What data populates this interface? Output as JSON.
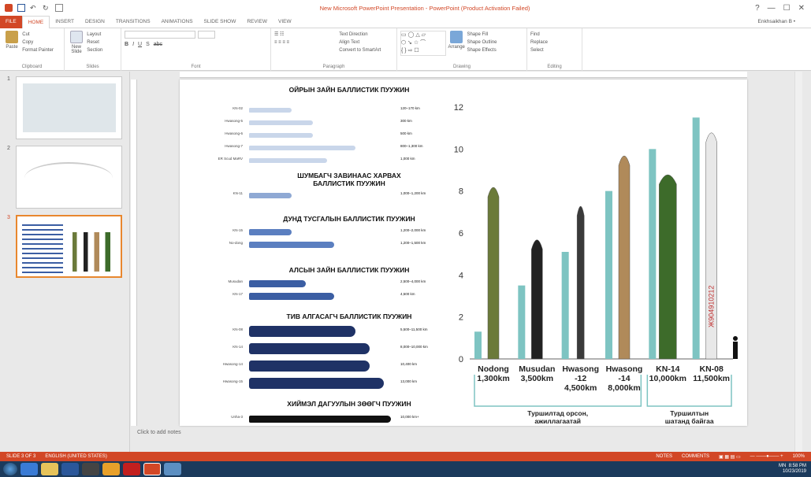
{
  "window": {
    "title": "New Microsoft PowerPoint Presentation - PowerPoint (Product Activation Failed)",
    "user": "Enkhsaikhan B •",
    "controls": [
      "?",
      "—",
      "☐",
      "✕"
    ]
  },
  "tabs": [
    "FILE",
    "HOME",
    "INSERT",
    "DESIGN",
    "TRANSITIONS",
    "ANIMATIONS",
    "SLIDE SHOW",
    "REVIEW",
    "VIEW"
  ],
  "ribbon": {
    "clipboard": {
      "label": "Clipboard",
      "paste": "Paste",
      "cut": "Cut",
      "copy": "Copy",
      "format_painter": "Format Painter"
    },
    "slides": {
      "label": "Slides",
      "new_slide": "New Slide",
      "layout": "Layout",
      "reset": "Reset",
      "section": "Section"
    },
    "font": {
      "label": "Font"
    },
    "paragraph": {
      "label": "Paragraph",
      "text_direction": "Text Direction",
      "align_text": "Align Text",
      "convert": "Convert to SmartArt"
    },
    "drawing": {
      "label": "Drawing",
      "arrange": "Arrange",
      "quick_styles": "Quick Styles",
      "shape_fill": "Shape Fill",
      "shape_outline": "Shape Outline",
      "shape_effects": "Shape Effects"
    },
    "editing": {
      "label": "Editing",
      "find": "Find",
      "replace": "Replace",
      "select": "Select"
    }
  },
  "thumbnails": [
    "1",
    "2",
    "3"
  ],
  "notes_placeholder": "Click to add notes",
  "status": {
    "slide": "SLIDE 3 OF 3",
    "language": "ENGLISH (UNITED STATES)",
    "notes": "NOTES",
    "comments": "COMMENTS",
    "zoom": "100%"
  },
  "clock": {
    "time": "8:58 PM",
    "date": "10/23/2019",
    "lang": "MN"
  },
  "infographic": {
    "sections": [
      {
        "title": "ОЙРЫН ЗАЙН БАЛЛИСТИК ПУУЖИН",
        "color": "#c9d6ea",
        "rows": [
          {
            "name": "KN-02",
            "range": "120–170 km",
            "len": 0.3
          },
          {
            "name": "Hwasong-5",
            "range": "300 km",
            "len": 0.45
          },
          {
            "name": "Hwasong-6",
            "range": "500 km",
            "len": 0.45
          },
          {
            "name": "Hwasong-7",
            "range": "800–1,300 km",
            "len": 0.75
          },
          {
            "name": "ER Scud MaRV",
            "range": "1,000 km",
            "len": 0.55
          }
        ]
      },
      {
        "title": "ШУМБАГЧ ЗАВИНААС ХАРВАХ БАЛЛИСТИК ПУУЖИН",
        "color": "#8fa9d4",
        "rows": [
          {
            "name": "KN-11",
            "range": "1,000–1,200 km",
            "len": 0.3
          }
        ]
      },
      {
        "title": "ДУНД ТУСГАЛЫН БАЛЛИСТИК ПУУЖИН",
        "color": "#5b7fc0",
        "rows": [
          {
            "name": "KN-15",
            "range": "1,200–2,000 km",
            "len": 0.3
          },
          {
            "name": "No-dong",
            "range": "1,200–1,500 km",
            "len": 0.6
          }
        ]
      },
      {
        "title": "АЛСЫН ЗАЙН БАЛЛИСТИК ПУУЖИН",
        "color": "#3b5ea3",
        "rows": [
          {
            "name": "Musudan",
            "range": "2,500–4,000 km",
            "len": 0.4
          },
          {
            "name": "KN-17",
            "range": "4,500 km",
            "len": 0.6
          }
        ]
      },
      {
        "title": "ТИВ АЛГАСАГЧ БАЛЛИСТИК ПУУЖИН",
        "color": "#1f3266",
        "rows": [
          {
            "name": "KN-08",
            "range": "5,500–11,500 km",
            "len": 0.75
          },
          {
            "name": "KN-14",
            "range": "8,000–10,000 km",
            "len": 0.85
          },
          {
            "name": "Hwasong-14",
            "range": "10,400 km",
            "len": 0.85
          },
          {
            "name": "Hwasong-15",
            "range": "13,000 km",
            "len": 0.95
          }
        ]
      },
      {
        "title": "ХИЙМЭЛ ДАГУУЛЫН ЗӨӨГЧ ПУУЖИН",
        "color": "#111111",
        "rows": [
          {
            "name": "Unha-3",
            "range": "10,000 km+",
            "len": 1.0
          }
        ]
      }
    ]
  },
  "chart_data": {
    "type": "bar",
    "title": "",
    "ylim": [
      0,
      12
    ],
    "yticks": [
      0,
      2,
      4,
      6,
      8,
      10,
      12
    ],
    "bar_color": "#7ec4c2",
    "categories": [
      "Nodong",
      "Musudan",
      "Hwasong -12",
      "Hwasong -14",
      "KN-14",
      "KN-08"
    ],
    "values": [
      1.3,
      3.5,
      5.1,
      8.0,
      10.0,
      11.5
    ],
    "range_labels": [
      "1,300km",
      "3,500km",
      "4,500km",
      "8,000km",
      "10,000km",
      "11,500km"
    ],
    "missile_colors": [
      "#6b7a3a",
      "#222222",
      "#3a3a3a",
      "#b08a5a",
      "#3d6b2a",
      "#e8e8e8"
    ],
    "missile_heights": [
      8.4,
      5.9,
      7.5,
      9.9,
      9.0,
      11.0
    ],
    "missile_text": [
      "",
      "",
      "",
      "",
      "",
      "Ж904910212"
    ],
    "groups": [
      {
        "label": "Туршилтад орсон, ажиллагаатай"
      },
      {
        "label": "Туршилтын шатанд байгаа"
      }
    ]
  }
}
